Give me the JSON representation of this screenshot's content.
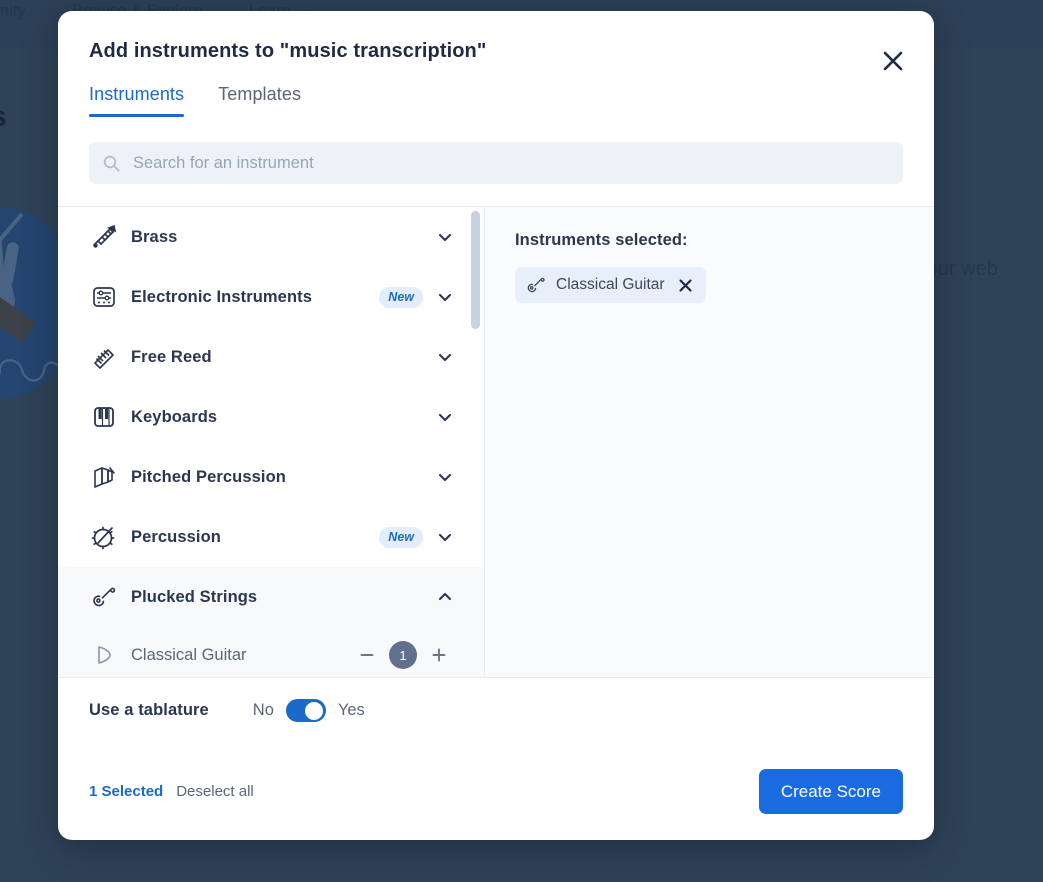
{
  "background": {
    "nav_items": [
      {
        "label": "nity",
        "caret": false
      },
      {
        "label": "Browse & Explore",
        "caret": false
      },
      {
        "label": "Learn",
        "caret": true
      }
    ],
    "heading": "s",
    "right_text": "h your web",
    "bg_color": "#2e4258"
  },
  "modal": {
    "title": "Add instruments to \"music transcription\"",
    "close_icon": "close-icon",
    "tabs": [
      {
        "label": "Instruments",
        "active": true
      },
      {
        "label": "Templates",
        "active": false
      }
    ],
    "search": {
      "icon": "search-icon",
      "placeholder": "Search for an instrument",
      "value": ""
    },
    "categories": [
      {
        "label": "Brass",
        "icon": "trumpet-icon",
        "badge": "",
        "expanded": false
      },
      {
        "label": "Electronic Instruments",
        "icon": "synthesizer-icon",
        "badge": "New",
        "expanded": false
      },
      {
        "label": "Free Reed",
        "icon": "accordion-icon",
        "badge": "",
        "expanded": false
      },
      {
        "label": "Keyboards",
        "icon": "piano-keys-icon",
        "badge": "",
        "expanded": false
      },
      {
        "label": "Pitched Percussion",
        "icon": "marimba-icon",
        "badge": "",
        "expanded": false
      },
      {
        "label": "Percussion",
        "icon": "tambourine-icon",
        "badge": "New",
        "expanded": false
      },
      {
        "label": "Plucked Strings",
        "icon": "guitar-icon",
        "badge": "",
        "expanded": true
      }
    ],
    "instruments": [
      {
        "label": "Classical Guitar",
        "icon": "instrument-shape-icon",
        "count": "1",
        "minus": "−",
        "plus": "+"
      }
    ],
    "selected_panel": {
      "title": "Instruments selected:",
      "chips": [
        {
          "label": "Classical Guitar",
          "icon": "guitar-icon",
          "remove_icon": "close-icon"
        }
      ]
    },
    "tablature": {
      "label": "Use a tablature",
      "off_label": "No",
      "on_label": "Yes",
      "value": "Yes"
    },
    "footer": {
      "selected_count_label": "1 Selected",
      "deselect_all_label": "Deselect all",
      "primary_button_label": "Create Score"
    },
    "accent_color": "#1b6ac9",
    "primary_button_color": "#1a6ae0"
  }
}
